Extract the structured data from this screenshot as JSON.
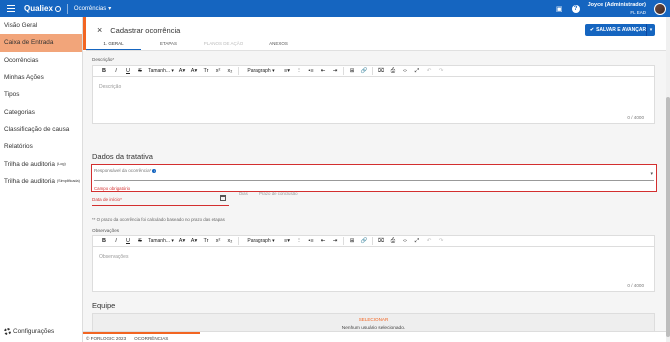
{
  "topbar": {
    "logo": "Qualiex",
    "module": "Ocorrências",
    "user_name": "Joyce (Administrador)",
    "user_org": "FL EAD"
  },
  "sidebar": {
    "items": [
      {
        "label": "Visão Geral"
      },
      {
        "label": "Caixa de Entrada"
      },
      {
        "label": "Ocorrências"
      },
      {
        "label": "Minhas Ações"
      },
      {
        "label": "Tipos"
      },
      {
        "label": "Categorias"
      },
      {
        "label": "Classificação de causa"
      },
      {
        "label": "Relatórios"
      },
      {
        "label": "Trilha de auditoria",
        "suffix": "(Log)"
      },
      {
        "label": "Trilha de auditoria",
        "suffix": "(Simplificada)"
      }
    ],
    "settings_label": "Configurações"
  },
  "header": {
    "title": "Cadastrar ocorrência",
    "save_label": "SALVAR E AVANÇAR"
  },
  "tabs": [
    {
      "label": "1. GERAL",
      "state": "active"
    },
    {
      "label": "ETAPAS",
      "state": "normal"
    },
    {
      "label": "PLANOS DE AÇÃO",
      "state": "disabled"
    },
    {
      "label": "ANEXOS",
      "state": "normal"
    }
  ],
  "editor": {
    "size_label": "Tamanh...",
    "paragraph_label": "Paragraph"
  },
  "description": {
    "label": "Descrição*",
    "placeholder": "Descrição",
    "count": "0 / 4000"
  },
  "tratativa": {
    "section_title": "Dados da tratativa",
    "responsavel_label": "Responsável da ocorrência*",
    "responsavel_error": "Campo obrigatório",
    "date_label": "Data de início*",
    "frag_1": "Dias",
    "frag_2": "Prazo de conclusão",
    "note": "** O prazo da ocorrência foi calculado baseado no prazo das etapas",
    "obs_label": "Observações",
    "obs_placeholder": "Observações",
    "obs_count": "0 / 4000"
  },
  "equipe": {
    "title": "Equipe",
    "select_label": "SELECIONAR",
    "empty_label": "Nenhum usuário selecionado."
  },
  "footer": {
    "copyright": "© FORLOGIC 2023",
    "module": "OCORRÊNCIAS"
  },
  "colors": {
    "primary": "#1565c0",
    "accent": "#f26522",
    "error": "#d32f2f",
    "active_nav": "#f2a57a"
  }
}
